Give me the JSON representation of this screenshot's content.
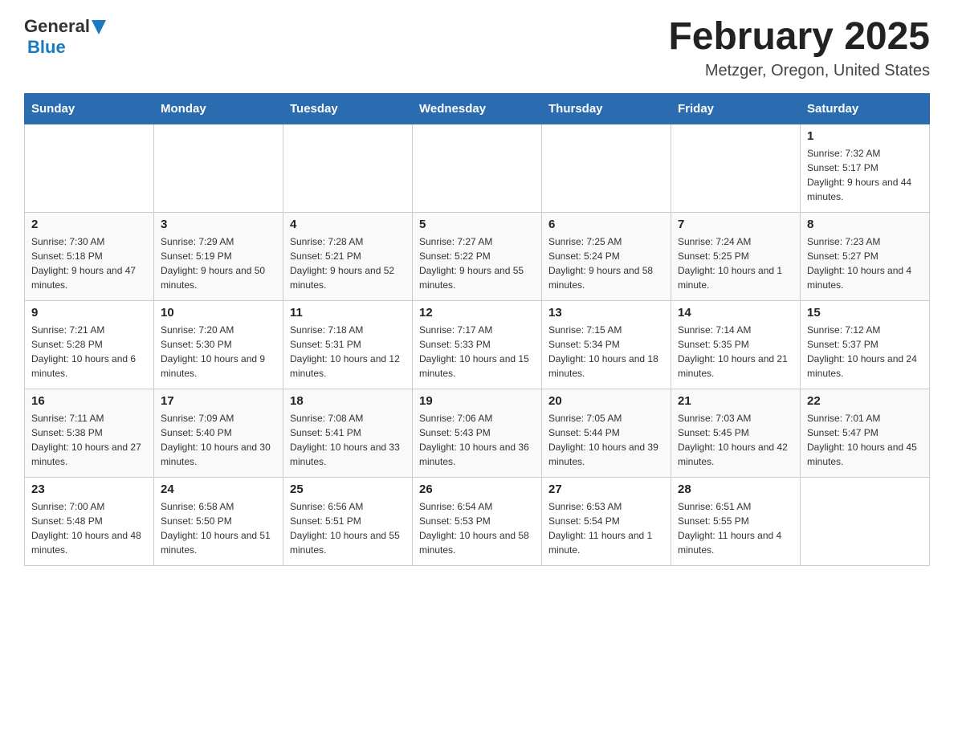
{
  "header": {
    "logo_general": "General",
    "logo_blue": "Blue",
    "month_title": "February 2025",
    "location": "Metzger, Oregon, United States"
  },
  "days_of_week": [
    "Sunday",
    "Monday",
    "Tuesday",
    "Wednesday",
    "Thursday",
    "Friday",
    "Saturday"
  ],
  "weeks": [
    {
      "days": [
        {
          "number": "",
          "info": ""
        },
        {
          "number": "",
          "info": ""
        },
        {
          "number": "",
          "info": ""
        },
        {
          "number": "",
          "info": ""
        },
        {
          "number": "",
          "info": ""
        },
        {
          "number": "",
          "info": ""
        },
        {
          "number": "1",
          "info": "Sunrise: 7:32 AM\nSunset: 5:17 PM\nDaylight: 9 hours and 44 minutes."
        }
      ]
    },
    {
      "days": [
        {
          "number": "2",
          "info": "Sunrise: 7:30 AM\nSunset: 5:18 PM\nDaylight: 9 hours and 47 minutes."
        },
        {
          "number": "3",
          "info": "Sunrise: 7:29 AM\nSunset: 5:19 PM\nDaylight: 9 hours and 50 minutes."
        },
        {
          "number": "4",
          "info": "Sunrise: 7:28 AM\nSunset: 5:21 PM\nDaylight: 9 hours and 52 minutes."
        },
        {
          "number": "5",
          "info": "Sunrise: 7:27 AM\nSunset: 5:22 PM\nDaylight: 9 hours and 55 minutes."
        },
        {
          "number": "6",
          "info": "Sunrise: 7:25 AM\nSunset: 5:24 PM\nDaylight: 9 hours and 58 minutes."
        },
        {
          "number": "7",
          "info": "Sunrise: 7:24 AM\nSunset: 5:25 PM\nDaylight: 10 hours and 1 minute."
        },
        {
          "number": "8",
          "info": "Sunrise: 7:23 AM\nSunset: 5:27 PM\nDaylight: 10 hours and 4 minutes."
        }
      ]
    },
    {
      "days": [
        {
          "number": "9",
          "info": "Sunrise: 7:21 AM\nSunset: 5:28 PM\nDaylight: 10 hours and 6 minutes."
        },
        {
          "number": "10",
          "info": "Sunrise: 7:20 AM\nSunset: 5:30 PM\nDaylight: 10 hours and 9 minutes."
        },
        {
          "number": "11",
          "info": "Sunrise: 7:18 AM\nSunset: 5:31 PM\nDaylight: 10 hours and 12 minutes."
        },
        {
          "number": "12",
          "info": "Sunrise: 7:17 AM\nSunset: 5:33 PM\nDaylight: 10 hours and 15 minutes."
        },
        {
          "number": "13",
          "info": "Sunrise: 7:15 AM\nSunset: 5:34 PM\nDaylight: 10 hours and 18 minutes."
        },
        {
          "number": "14",
          "info": "Sunrise: 7:14 AM\nSunset: 5:35 PM\nDaylight: 10 hours and 21 minutes."
        },
        {
          "number": "15",
          "info": "Sunrise: 7:12 AM\nSunset: 5:37 PM\nDaylight: 10 hours and 24 minutes."
        }
      ]
    },
    {
      "days": [
        {
          "number": "16",
          "info": "Sunrise: 7:11 AM\nSunset: 5:38 PM\nDaylight: 10 hours and 27 minutes."
        },
        {
          "number": "17",
          "info": "Sunrise: 7:09 AM\nSunset: 5:40 PM\nDaylight: 10 hours and 30 minutes."
        },
        {
          "number": "18",
          "info": "Sunrise: 7:08 AM\nSunset: 5:41 PM\nDaylight: 10 hours and 33 minutes."
        },
        {
          "number": "19",
          "info": "Sunrise: 7:06 AM\nSunset: 5:43 PM\nDaylight: 10 hours and 36 minutes."
        },
        {
          "number": "20",
          "info": "Sunrise: 7:05 AM\nSunset: 5:44 PM\nDaylight: 10 hours and 39 minutes."
        },
        {
          "number": "21",
          "info": "Sunrise: 7:03 AM\nSunset: 5:45 PM\nDaylight: 10 hours and 42 minutes."
        },
        {
          "number": "22",
          "info": "Sunrise: 7:01 AM\nSunset: 5:47 PM\nDaylight: 10 hours and 45 minutes."
        }
      ]
    },
    {
      "days": [
        {
          "number": "23",
          "info": "Sunrise: 7:00 AM\nSunset: 5:48 PM\nDaylight: 10 hours and 48 minutes."
        },
        {
          "number": "24",
          "info": "Sunrise: 6:58 AM\nSunset: 5:50 PM\nDaylight: 10 hours and 51 minutes."
        },
        {
          "number": "25",
          "info": "Sunrise: 6:56 AM\nSunset: 5:51 PM\nDaylight: 10 hours and 55 minutes."
        },
        {
          "number": "26",
          "info": "Sunrise: 6:54 AM\nSunset: 5:53 PM\nDaylight: 10 hours and 58 minutes."
        },
        {
          "number": "27",
          "info": "Sunrise: 6:53 AM\nSunset: 5:54 PM\nDaylight: 11 hours and 1 minute."
        },
        {
          "number": "28",
          "info": "Sunrise: 6:51 AM\nSunset: 5:55 PM\nDaylight: 11 hours and 4 minutes."
        },
        {
          "number": "",
          "info": ""
        }
      ]
    }
  ]
}
